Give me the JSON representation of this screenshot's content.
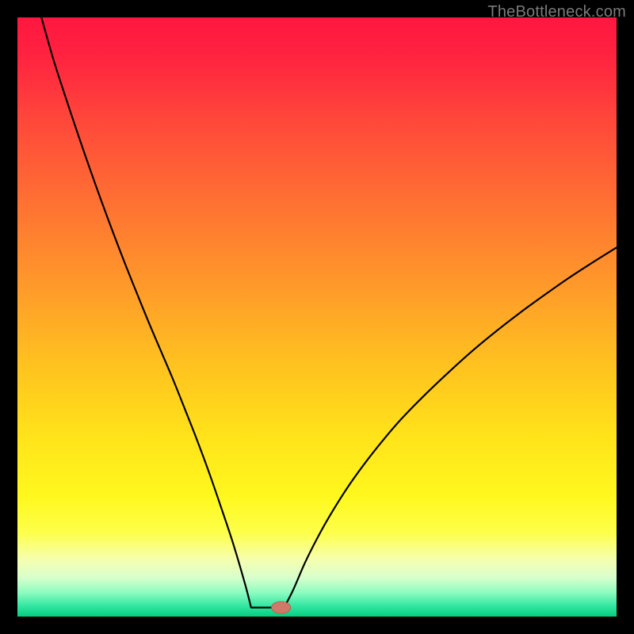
{
  "watermark": "TheBottleneck.com",
  "colors": {
    "black": "#000000",
    "curve": "#000000",
    "marker_fill": "#cf7a68",
    "marker_stroke": "#b75c4a"
  },
  "gradient_stops": [
    {
      "offset": 0.0,
      "color": "#ff163f"
    },
    {
      "offset": 0.07,
      "color": "#ff2540"
    },
    {
      "offset": 0.18,
      "color": "#ff4a3a"
    },
    {
      "offset": 0.3,
      "color": "#ff6e33"
    },
    {
      "offset": 0.45,
      "color": "#ff9a2a"
    },
    {
      "offset": 0.58,
      "color": "#ffc21f"
    },
    {
      "offset": 0.7,
      "color": "#ffe31a"
    },
    {
      "offset": 0.8,
      "color": "#fff81e"
    },
    {
      "offset": 0.86,
      "color": "#fdff4a"
    },
    {
      "offset": 0.905,
      "color": "#f6ffb0"
    },
    {
      "offset": 0.935,
      "color": "#d8ffcc"
    },
    {
      "offset": 0.96,
      "color": "#8dfcc0"
    },
    {
      "offset": 0.982,
      "color": "#34e6a2"
    },
    {
      "offset": 1.0,
      "color": "#04cf7f"
    }
  ],
  "chart_data": {
    "type": "line",
    "title": "",
    "xlabel": "",
    "ylabel": "",
    "xlim": [
      0,
      100
    ],
    "ylim": [
      0,
      100
    ],
    "flat_bottom": {
      "x_start": 39,
      "x_end": 44.5,
      "y": 1.5
    },
    "marker": {
      "x": 44,
      "y": 1.5,
      "rx": 1.6,
      "ry": 1.0
    },
    "series": [
      {
        "name": "left-branch",
        "x": [
          4,
          6,
          8,
          10,
          12,
          14,
          16,
          18,
          20,
          22,
          24,
          26,
          28,
          30,
          32,
          34,
          36,
          38,
          39
        ],
        "y": [
          100,
          93,
          86.8,
          80.8,
          75,
          69.4,
          64,
          58.8,
          53.8,
          48.9,
          44.2,
          39.5,
          34.5,
          29.4,
          24,
          18.2,
          12.2,
          5.4,
          1.5
        ]
      },
      {
        "name": "right-branch",
        "x": [
          44.5,
          46,
          48,
          50,
          52,
          55,
          58,
          61,
          64,
          68,
          72,
          76,
          80,
          84,
          88,
          92,
          96,
          100
        ],
        "y": [
          1.5,
          4.4,
          9.0,
          13.0,
          16.6,
          21.4,
          25.6,
          29.4,
          32.9,
          37.0,
          40.8,
          44.4,
          47.7,
          50.8,
          53.7,
          56.5,
          59.1,
          61.6
        ]
      }
    ]
  }
}
